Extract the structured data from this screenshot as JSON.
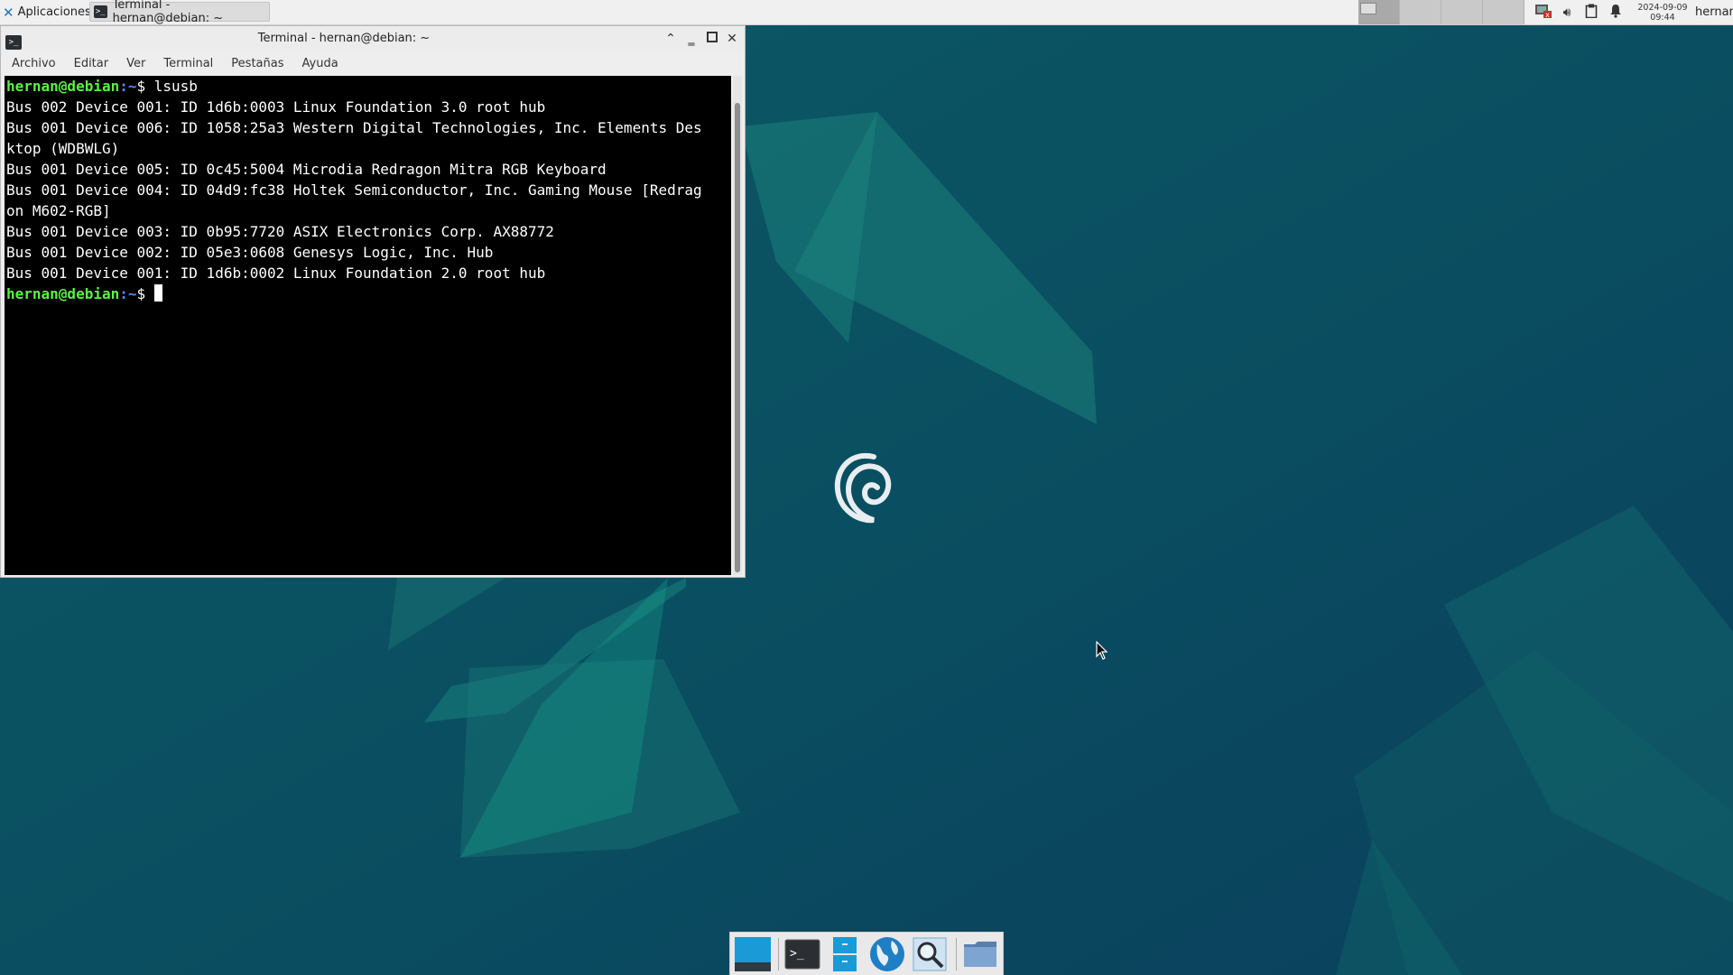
{
  "top_panel": {
    "apps_menu_label": "Aplicaciones",
    "task_label": "Terminal - hernan@debian: ~",
    "clock_date": "2024-09-09",
    "clock_time": "09:44",
    "user": "hernan",
    "tray_icons": [
      "network-disconnected-icon",
      "volume-icon",
      "clipboard-icon",
      "notification-bell-icon"
    ]
  },
  "terminal": {
    "title": "Terminal - hernan@debian: ~",
    "menu": [
      "Archivo",
      "Editar",
      "Ver",
      "Terminal",
      "Pestañas",
      "Ayuda"
    ],
    "prompt_user": "hernan@debian",
    "prompt_path": ":~",
    "prompt_symbol": "$",
    "command": " lsusb",
    "output": [
      "Bus 002 Device 001: ID 1d6b:0003 Linux Foundation 3.0 root hub",
      "Bus 001 Device 006: ID 1058:25a3 Western Digital Technologies, Inc. Elements Des",
      "ktop (WDBWLG)",
      "Bus 001 Device 005: ID 0c45:5004 Microdia Redragon Mitra RGB Keyboard",
      "Bus 001 Device 004: ID 04d9:fc38 Holtek Semiconductor, Inc. Gaming Mouse [Redrag",
      "on M602-RGB]",
      "Bus 001 Device 003: ID 0b95:7720 ASIX Electronics Corp. AX88772",
      "Bus 001 Device 002: ID 05e3:0608 Genesys Logic, Inc. Hub",
      "Bus 001 Device 001: ID 1d6b:0002 Linux Foundation 2.0 root hub"
    ],
    "second_prompt_symbol": "$ "
  },
  "dock": {
    "items": [
      "show-desktop-icon",
      "terminal-icon",
      "file-manager-icon",
      "web-browser-icon",
      "search-icon",
      "folder-icon"
    ]
  }
}
